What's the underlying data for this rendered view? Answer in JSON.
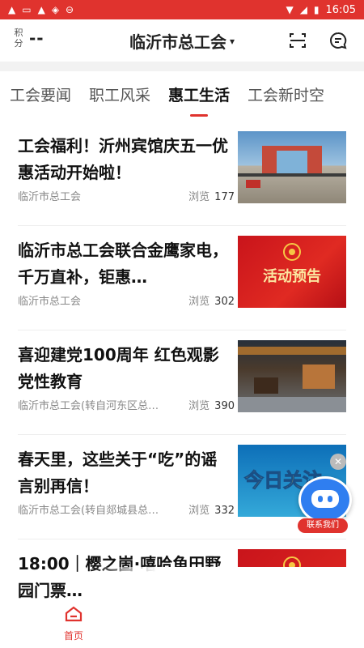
{
  "status": {
    "time": "16:05"
  },
  "header": {
    "score_label": "积分",
    "score_value": "--",
    "title": "临沂市总工会"
  },
  "tabs": [
    {
      "label": "工会要闻",
      "active": false
    },
    {
      "label": "职工风采",
      "active": false
    },
    {
      "label": "惠工生活",
      "active": true
    },
    {
      "label": "工会新时空",
      "active": false
    }
  ],
  "articles": [
    {
      "title": "工会福利！沂州宾馆庆五一优惠活动开始啦！",
      "source": "临沂市总工会",
      "views_label": "浏览",
      "views": "177"
    },
    {
      "title": "临沂市总工会联合金鹰家电，千万直补，钜惠…",
      "source": "临沂市总工会",
      "views_label": "浏览",
      "views": "302",
      "thumb_text": "活动预告"
    },
    {
      "title": "喜迎建党100周年 红色观影党性教育",
      "source": "临沂市总工会(转自河东区总…",
      "views_label": "浏览",
      "views": "390"
    },
    {
      "title": "春天里，这些关于“吃”的谣言别再信！",
      "source": "临沂市总工会(转自郯城县总…",
      "views_label": "浏览",
      "views": "332",
      "thumb_text": "今日关注"
    },
    {
      "title": "18:00｜樱之崮·嘻哈鱼田野园门票…",
      "source": "",
      "views_label": "",
      "views": ""
    }
  ],
  "float_widget": {
    "label": "联系我们"
  },
  "bottom_nav": {
    "home_label": "首页"
  },
  "colors": {
    "accent": "#e0332e"
  }
}
